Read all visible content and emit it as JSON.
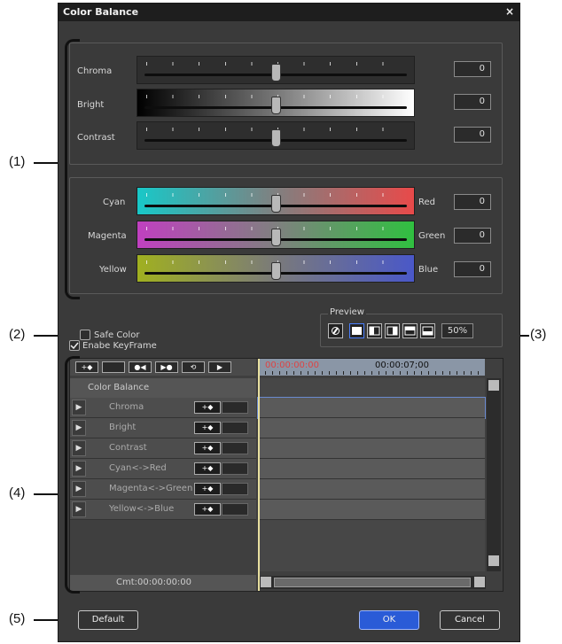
{
  "window": {
    "title": "Color Balance",
    "close": "×"
  },
  "callouts": {
    "c1": "(1)",
    "c2": "(2)",
    "c3": "(3)",
    "c4": "(4)",
    "c5": "(5)"
  },
  "basic": {
    "chroma": {
      "label": "Chroma",
      "value": "0"
    },
    "bright": {
      "label": "Bright",
      "value": "0"
    },
    "contrast": {
      "label": "Contrast",
      "value": "0"
    }
  },
  "color": {
    "cyan_red": {
      "left": "Cyan",
      "right": "Red",
      "value": "0"
    },
    "magenta_green": {
      "left": "Magenta",
      "right": "Green",
      "value": "0"
    },
    "yellow_blue": {
      "left": "Yellow",
      "right": "Blue",
      "value": "0"
    }
  },
  "safe_color": {
    "label": "Safe Color",
    "checked": false
  },
  "preview": {
    "label": "Preview",
    "zoom": "50%"
  },
  "keyframe": {
    "enable_label": "Enabe KeyFrame",
    "checked": true,
    "header": "Color Balance",
    "time_start": "00:00:00:00",
    "time_mark": "00:00:07;00",
    "current": "Cmt:00:00:00:00",
    "rows": [
      {
        "label": "Chroma"
      },
      {
        "label": "Bright"
      },
      {
        "label": "Contrast"
      },
      {
        "label": "Cyan<->Red"
      },
      {
        "label": "Magenta<->Green"
      },
      {
        "label": "Yellow<->Blue"
      }
    ]
  },
  "footer": {
    "default": "Default",
    "ok": "OK",
    "cancel": "Cancel"
  },
  "colors": {
    "ok_bg": "#2a5bd7",
    "bg": "#3a3a3a",
    "title_bg": "#1e1e1e",
    "timeline_line": "#e8e0a0"
  }
}
